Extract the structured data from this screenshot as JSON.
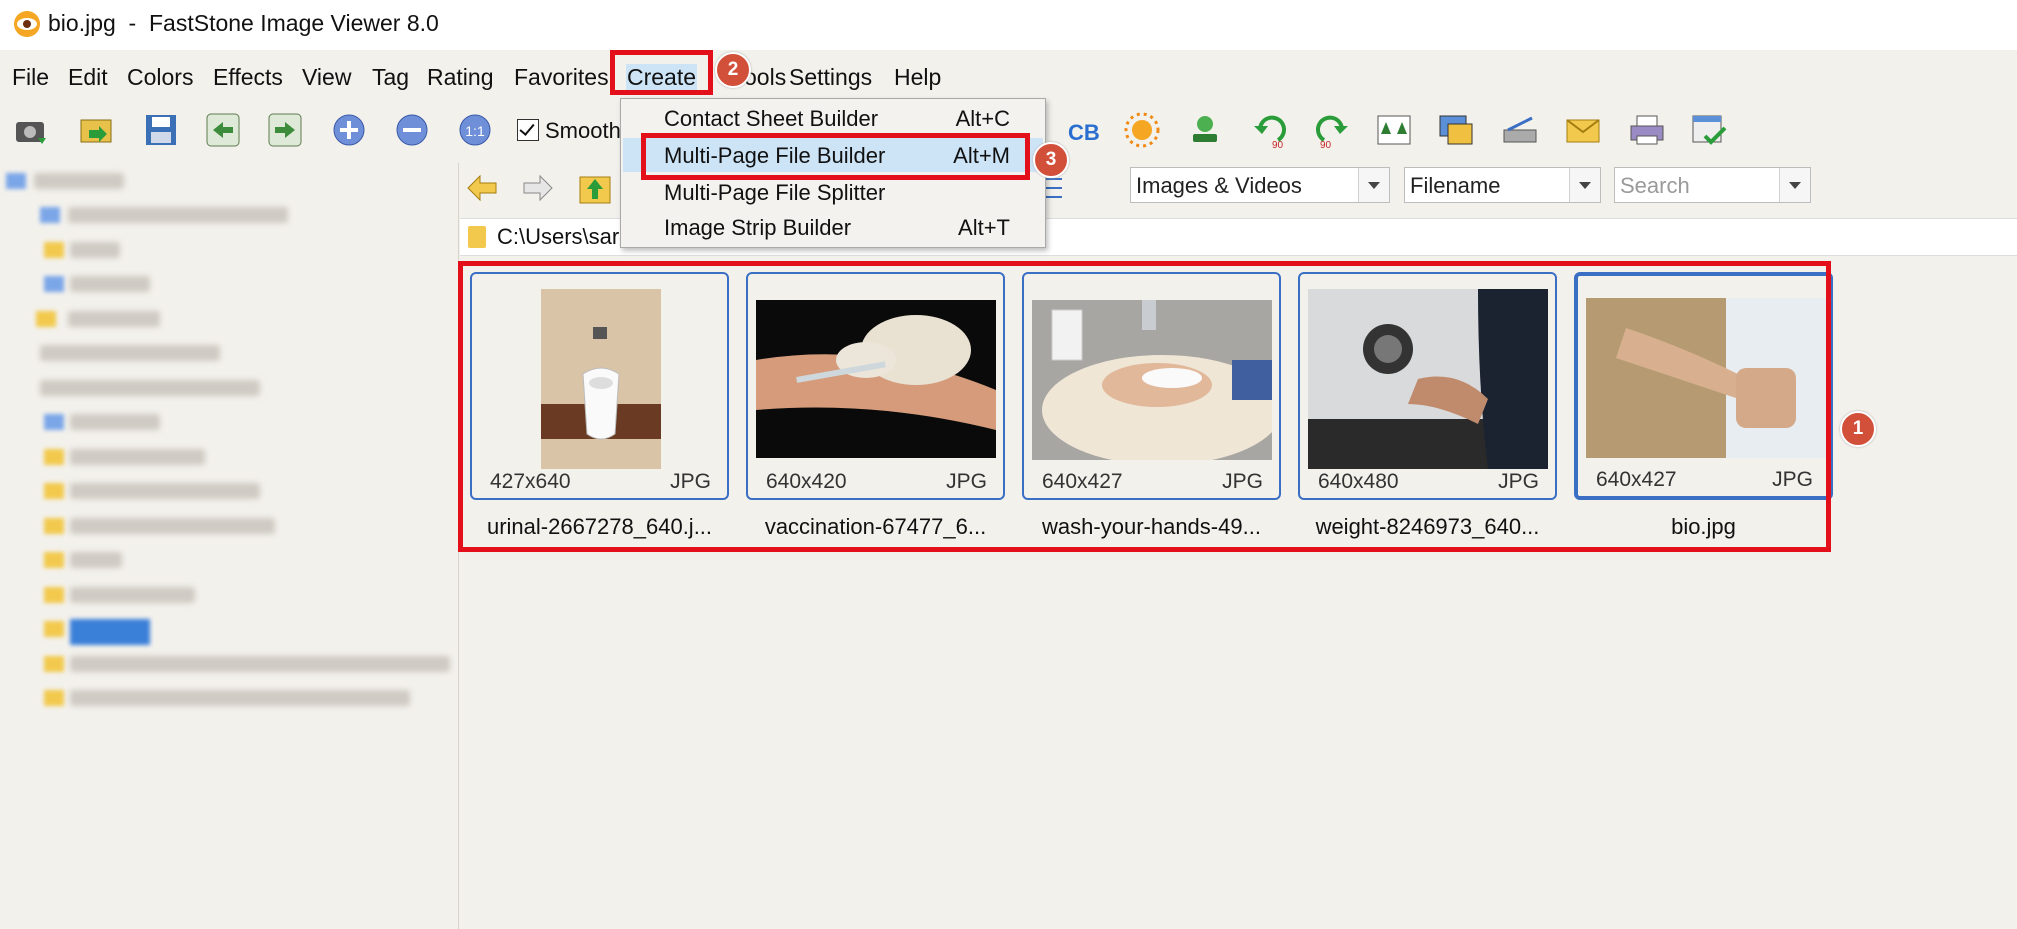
{
  "window": {
    "title": "bio.jpg  -  FastStone Image Viewer 8.0"
  },
  "menubar": {
    "items": [
      "File",
      "Edit",
      "Colors",
      "Effects",
      "View",
      "Tag",
      "Rating",
      "Favorites",
      "Create",
      "ools",
      "Settings",
      "Help"
    ]
  },
  "toolbar": {
    "smooth_label": "Smooth"
  },
  "filters": {
    "type_value": "Images & Videos",
    "sort_value": "Filename",
    "search_placeholder": "Search"
  },
  "path": {
    "text": "C:\\Users\\sar"
  },
  "dropdown": {
    "items": [
      {
        "label": "Contact Sheet Builder",
        "shortcut": "Alt+C"
      },
      {
        "label": "Multi-Page File Builder",
        "shortcut": "Alt+M"
      },
      {
        "label": "Multi-Page File Splitter",
        "shortcut": ""
      },
      {
        "label": "Image Strip Builder",
        "shortcut": "Alt+T"
      }
    ]
  },
  "thumbnails": [
    {
      "dim": "427x640",
      "ext": "JPG",
      "name": "urinal-2667278_640.j..."
    },
    {
      "dim": "640x420",
      "ext": "JPG",
      "name": "vaccination-67477_6..."
    },
    {
      "dim": "640x427",
      "ext": "JPG",
      "name": "wash-your-hands-49..."
    },
    {
      "dim": "640x480",
      "ext": "JPG",
      "name": "weight-8246973_640..."
    },
    {
      "dim": "640x427",
      "ext": "JPG",
      "name": "bio.jpg"
    }
  ],
  "badges": {
    "b1": "1",
    "b2": "2",
    "b3": "3"
  },
  "colors": {
    "annotation_red": "#e3101b",
    "selection_blue": "#3a6fc4",
    "badge": "#d2503a"
  }
}
